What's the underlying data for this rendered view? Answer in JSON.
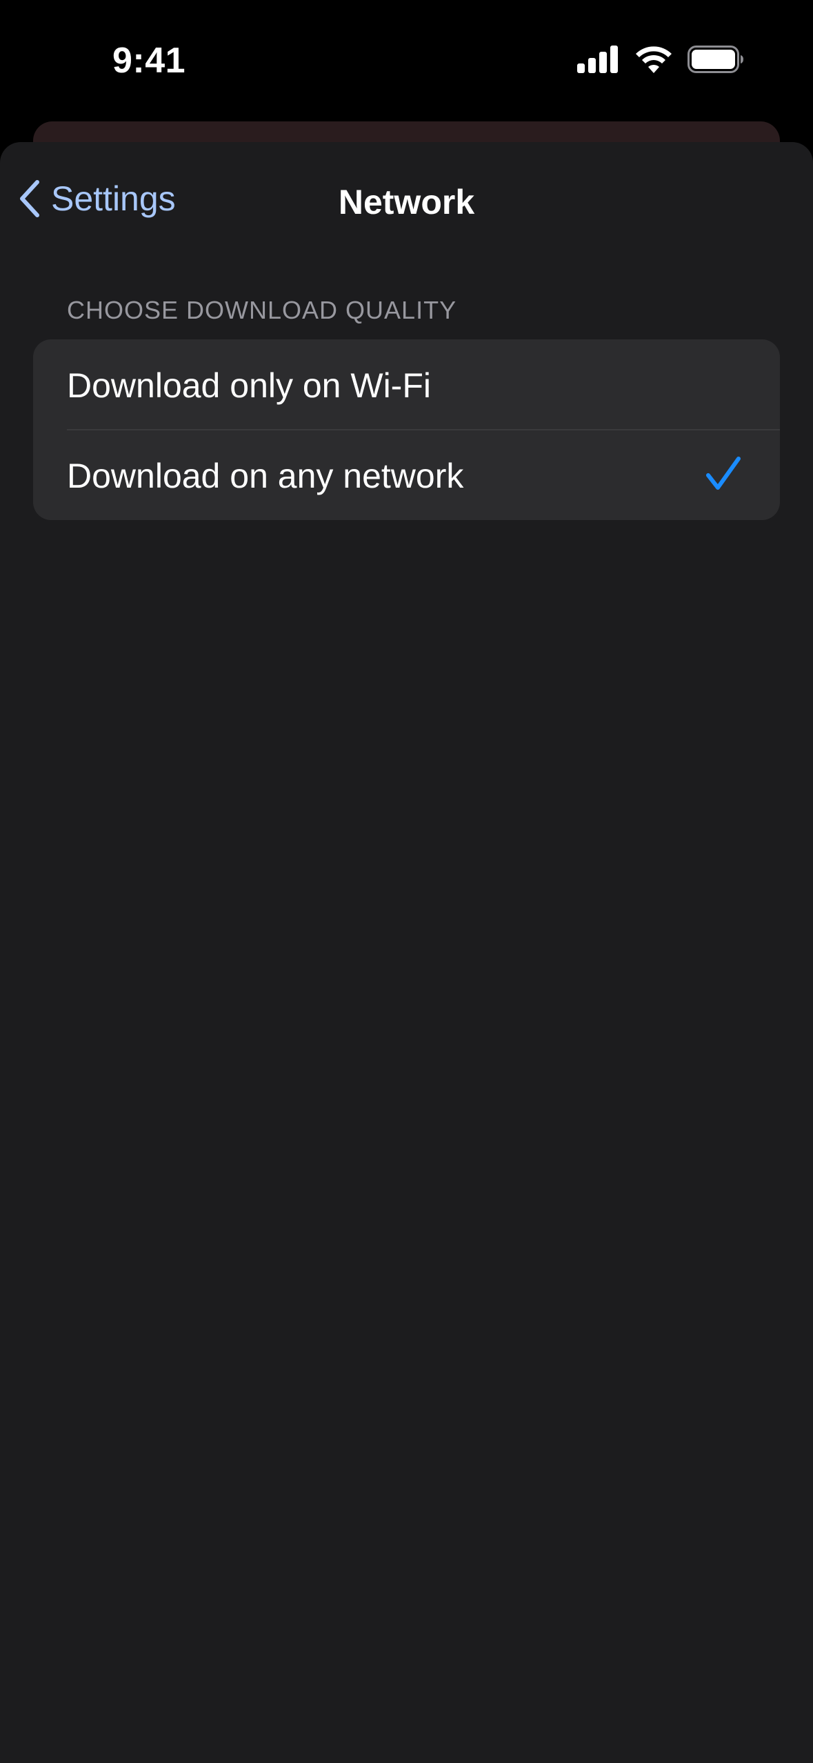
{
  "status_bar": {
    "time": "9:41",
    "icons": [
      "cellular-signal-icon",
      "wifi-icon",
      "battery-icon"
    ]
  },
  "nav": {
    "back_label": "Settings",
    "title": "Network"
  },
  "section": {
    "header": "CHOOSE DOWNLOAD QUALITY",
    "options": [
      {
        "label": "Download only on Wi-Fi",
        "selected": false
      },
      {
        "label": "Download on any network",
        "selected": true
      }
    ]
  },
  "colors": {
    "accent": "#a8c7fa",
    "checkmark": "#1a8cff",
    "sheet_background": "#1c1c1e",
    "group_background": "#2c2c2e"
  }
}
